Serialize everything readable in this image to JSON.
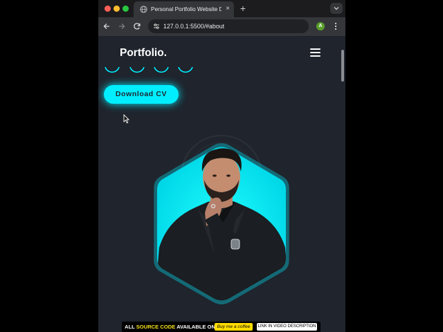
{
  "browser": {
    "tab_title": "Personal Portfolio Website De",
    "url": "127.0.0.1:5500/#about",
    "profile_initial": "A",
    "new_tab_symbol": "+",
    "close_symbol": "×"
  },
  "site": {
    "logo_text": "Portfolio",
    "logo_dot": ".",
    "download_cv_label": "Download CV",
    "accent_color": "#00eeff",
    "background_color": "#1f242d"
  },
  "social_icons": [
    "facebook-icon",
    "twitter-icon",
    "instagram-icon",
    "linkedin-icon"
  ],
  "promo_banner": {
    "prefix": "ALL ",
    "highlight": "SOURCE CODE",
    "suffix": " AVAILABLE ON",
    "coffee_label": "Buy me a coffee",
    "link_label": "LINK IN VIDEO DESCRIPTION"
  },
  "icons": {
    "traffic_lights": [
      "#ff5f57",
      "#febc2e",
      "#28c840"
    ],
    "toolbar": [
      "back-arrow-icon",
      "forward-arrow-icon",
      "reload-icon",
      "site-info-icon",
      "bookmark-star-icon",
      "kebab-menu-icon"
    ]
  }
}
